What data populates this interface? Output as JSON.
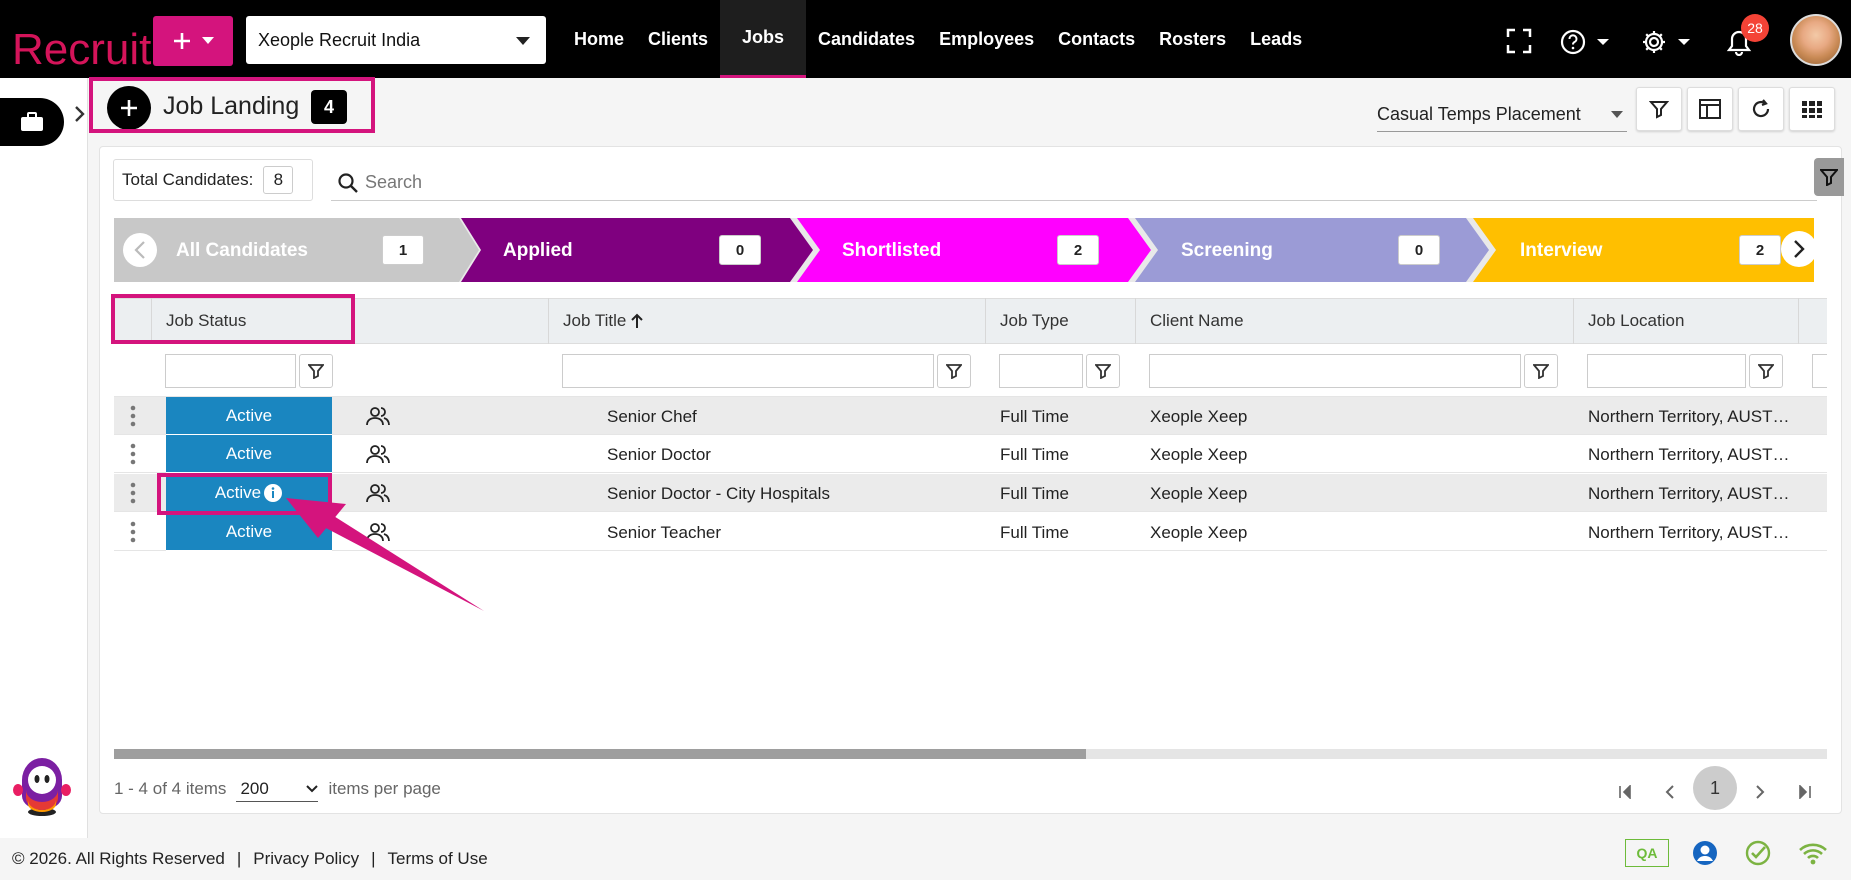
{
  "app": {
    "logo": "Recruit",
    "company": "Xeople Recruit India",
    "notifications": "28"
  },
  "nav": [
    "Home",
    "Clients",
    "Jobs",
    "Candidates",
    "Employees",
    "Contacts",
    "Rosters",
    "Leads"
  ],
  "header": {
    "title": "Job Landing",
    "count": "4",
    "placement": "Casual Temps Placement"
  },
  "toolbar": {
    "total_label": "Total Candidates:",
    "total_count": "8",
    "search_placeholder": "Search"
  },
  "pipeline": [
    {
      "label": "All Candidates",
      "count": "1",
      "color": "#c8c8c8"
    },
    {
      "label": "Applied",
      "count": "0",
      "color": "#7f007f"
    },
    {
      "label": "Shortlisted",
      "count": "2",
      "color": "#ff00ff"
    },
    {
      "label": "Screening",
      "count": "0",
      "color": "#9b9bd6"
    },
    {
      "label": "Interview",
      "count": "2",
      "color": "#ffbf00"
    }
  ],
  "columns": [
    "Job Status",
    "Job Title",
    "Job Type",
    "Client Name",
    "Job Location"
  ],
  "rows": [
    {
      "status": "Active",
      "title": "Senior Chef",
      "type": "Full Time",
      "client": "Xeople Xeep",
      "location": "Northern Territory, AUSTRALIA"
    },
    {
      "status": "Active",
      "title": "Senior Doctor",
      "type": "Full Time",
      "client": "Xeople Xeep",
      "location": "Northern Territory, AUSTRALIA"
    },
    {
      "status": "Active",
      "title": "Senior Doctor - City Hospitals",
      "type": "Full Time",
      "client": "Xeople Xeep",
      "location": "Northern Territory, AUSTRALIA"
    },
    {
      "status": "Active",
      "title": "Senior Teacher",
      "type": "Full Time",
      "client": "Xeople Xeep",
      "location": "Northern Territory, AUSTRALIA"
    }
  ],
  "pager": {
    "summary": "1 - 4 of 4 items",
    "page_size": "200",
    "per_page_label": "items per page",
    "current_page": "1"
  },
  "footer": {
    "copyright": "© 2026. All Rights Reserved",
    "privacy": "Privacy Policy",
    "terms": "Terms of Use",
    "env": "QA"
  },
  "colors": {
    "brand": "#d4147d",
    "status_active": "#1a86c0",
    "topbar": "#000000"
  }
}
